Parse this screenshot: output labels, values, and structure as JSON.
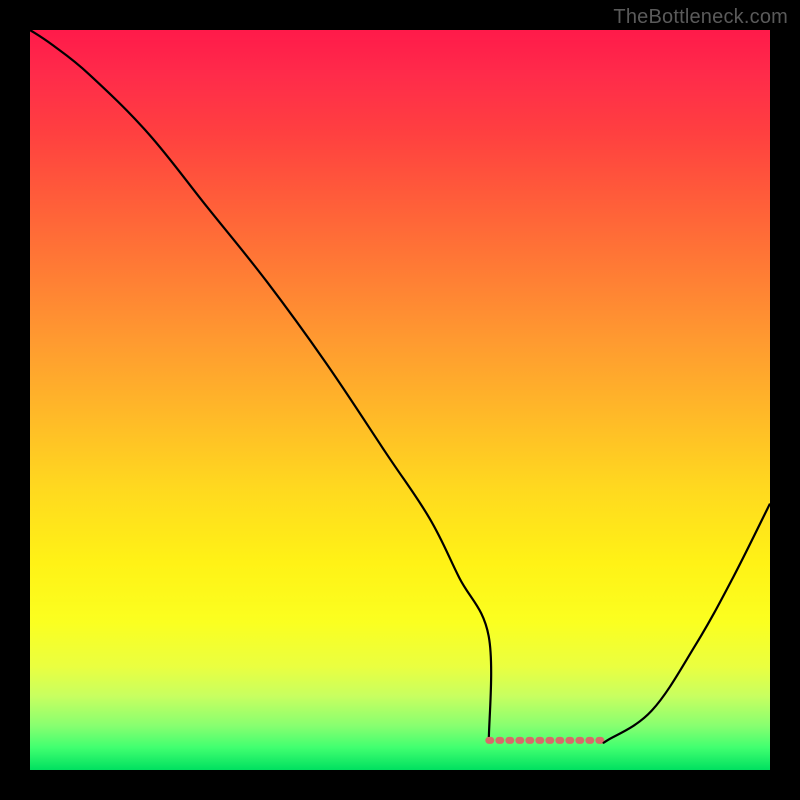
{
  "watermark": "TheBottleneck.com",
  "chart_data": {
    "type": "line",
    "title": "",
    "xlabel": "",
    "ylabel": "",
    "xlim": [
      0,
      100
    ],
    "ylim": [
      0,
      100
    ],
    "series": [
      {
        "name": "curve",
        "x": [
          0,
          3,
          8,
          16,
          24,
          32,
          40,
          48,
          54,
          58,
          62,
          66,
          68,
          70,
          78,
          84,
          90,
          95,
          100
        ],
        "values": [
          100,
          98,
          94,
          86,
          76,
          66,
          55,
          43,
          34,
          26,
          18,
          10,
          6,
          4,
          4,
          8,
          17,
          26,
          36
        ]
      }
    ],
    "flat_region": {
      "x_start": 62,
      "x_end": 78,
      "y": 4
    },
    "background_gradient": {
      "top": "#ff1a4a",
      "mid": "#fff216",
      "bottom": "#00e060"
    }
  }
}
